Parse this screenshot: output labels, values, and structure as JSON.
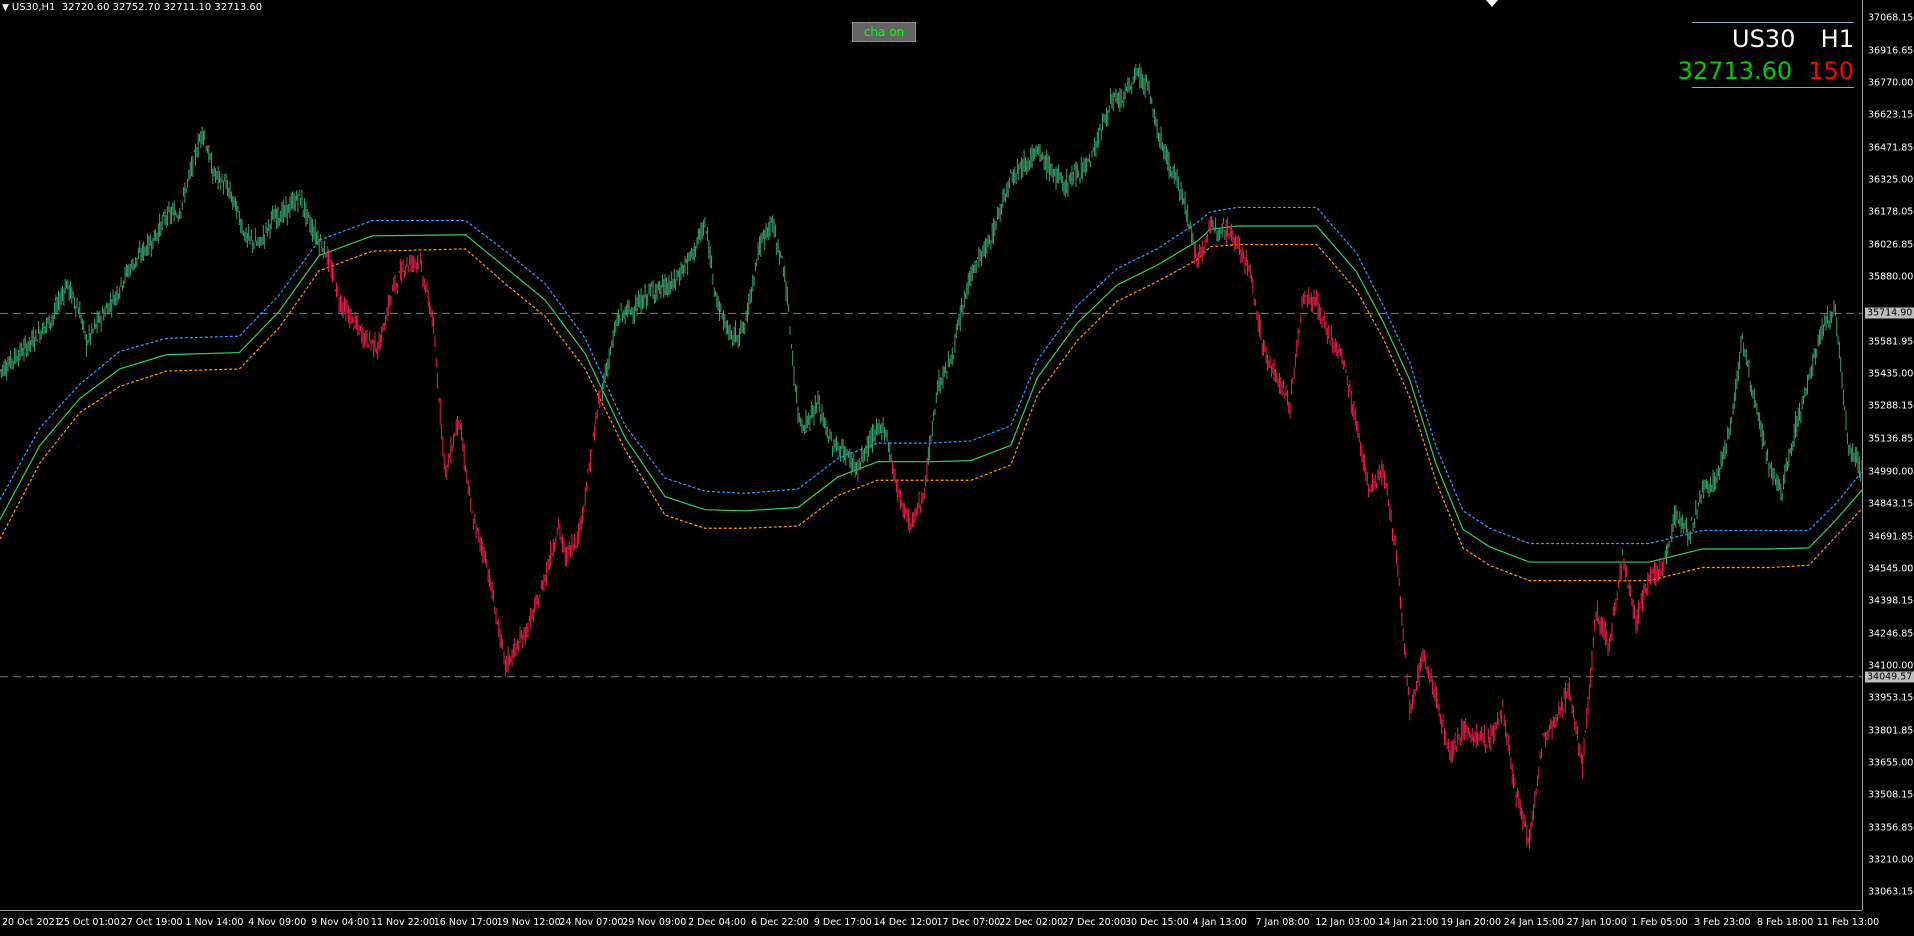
{
  "header": {
    "symbol_tf": "US30,H1",
    "ohlc": "32720.60 32752.70 32711.10 32713.60"
  },
  "button": {
    "label": "cha on"
  },
  "symbol_panel": {
    "symbol": "US30",
    "timeframe": "H1",
    "price": "32713.60",
    "spread": "150"
  },
  "colors": {
    "bull": "#3aa070",
    "bear": "#e8204a",
    "blue_band": "#3399ff",
    "orange_band": "#ff9900",
    "red_line": "#ff0000",
    "green_line": "#33cc66"
  },
  "y_axis": {
    "labels": [
      "37068.15",
      "36916.65",
      "36770.00",
      "36623.15",
      "36471.85",
      "36325.00",
      "36178.05",
      "36026.85",
      "35880.00",
      "35581.95",
      "35435.00",
      "35288.15",
      "35136.85",
      "34990.00",
      "34843.15",
      "34691.85",
      "34545.00",
      "34398.15",
      "34246.85",
      "34100.00",
      "33953.15",
      "33801.85",
      "33655.00",
      "33508.15",
      "33356.85",
      "33210.00",
      "33063.15"
    ],
    "tag_upper": "35714.90",
    "tag_lower": "34049.57"
  },
  "x_axis": {
    "labels": [
      "20 Oct 2021",
      "25 Oct 01:00",
      "27 Oct 19:00",
      "1 Nov 14:00",
      "4 Nov 09:00",
      "9 Nov 04:00",
      "11 Nov 22:00",
      "16 Nov 17:00",
      "19 Nov 12:00",
      "24 Nov 07:00",
      "29 Nov 09:00",
      "2 Dec 04:00",
      "6 Dec 22:00",
      "9 Dec 17:00",
      "14 Dec 12:00",
      "17 Dec 07:00",
      "22 Dec 02:00",
      "27 Dec 20:00",
      "30 Dec 15:00",
      "4 Jan 13:00",
      "7 Jan 08:00",
      "12 Jan 03:00",
      "14 Jan 21:00",
      "19 Jan 20:00",
      "24 Jan 15:00",
      "27 Jan 10:00",
      "1 Feb 05:00",
      "3 Feb 23:00",
      "8 Feb 18:00",
      "11 Feb 13:00"
    ]
  },
  "chart_data": {
    "type": "line",
    "ylim": [
      33063.15,
      37068.15
    ],
    "price_path": [
      [
        0,
        35450
      ],
      [
        40,
        35560
      ],
      [
        80,
        35700
      ],
      [
        100,
        35850
      ],
      [
        120,
        35720
      ],
      [
        130,
        35580
      ],
      [
        150,
        35690
      ],
      [
        175,
        35800
      ],
      [
        190,
        35900
      ],
      [
        210,
        35980
      ],
      [
        230,
        36050
      ],
      [
        250,
        36160
      ],
      [
        270,
        36180
      ],
      [
        290,
        36400
      ],
      [
        305,
        36560
      ],
      [
        320,
        36360
      ],
      [
        340,
        36300
      ],
      [
        355,
        36200
      ],
      [
        370,
        36060
      ],
      [
        390,
        36030
      ],
      [
        410,
        36150
      ],
      [
        430,
        36180
      ],
      [
        450,
        36250
      ],
      [
        470,
        36100
      ],
      [
        490,
        36000
      ],
      [
        510,
        35780
      ],
      [
        530,
        35680
      ],
      [
        550,
        35600
      ],
      [
        570,
        35560
      ],
      [
        590,
        35820
      ],
      [
        610,
        35940
      ],
      [
        630,
        35960
      ],
      [
        650,
        35700
      ],
      [
        670,
        34980
      ],
      [
        690,
        35240
      ],
      [
        710,
        34780
      ],
      [
        730,
        34600
      ],
      [
        760,
        34100
      ],
      [
        790,
        34250
      ],
      [
        810,
        34400
      ],
      [
        840,
        34740
      ],
      [
        850,
        34600
      ],
      [
        870,
        34700
      ],
      [
        880,
        34880
      ],
      [
        900,
        35300
      ],
      [
        930,
        35700
      ],
      [
        960,
        35750
      ],
      [
        980,
        35820
      ],
      [
        1010,
        35840
      ],
      [
        1040,
        35980
      ],
      [
        1060,
        36120
      ],
      [
        1080,
        35750
      ],
      [
        1100,
        35600
      ],
      [
        1120,
        35650
      ],
      [
        1140,
        36000
      ],
      [
        1160,
        36140
      ],
      [
        1180,
        35900
      ],
      [
        1200,
        35250
      ],
      [
        1210,
        35200
      ],
      [
        1230,
        35300
      ],
      [
        1250,
        35120
      ],
      [
        1270,
        35080
      ],
      [
        1290,
        35000
      ],
      [
        1310,
        35140
      ],
      [
        1330,
        35200
      ],
      [
        1350,
        34900
      ],
      [
        1370,
        34740
      ],
      [
        1390,
        34900
      ],
      [
        1410,
        35380
      ],
      [
        1430,
        35500
      ],
      [
        1460,
        35900
      ],
      [
        1490,
        36050
      ],
      [
        1520,
        36350
      ],
      [
        1560,
        36450
      ],
      [
        1600,
        36300
      ],
      [
        1640,
        36420
      ],
      [
        1670,
        36680
      ],
      [
        1690,
        36700
      ],
      [
        1710,
        36820
      ],
      [
        1725,
        36760
      ],
      [
        1740,
        36560
      ],
      [
        1760,
        36380
      ],
      [
        1780,
        36250
      ],
      [
        1800,
        35950
      ],
      [
        1820,
        36100
      ],
      [
        1840,
        36120
      ],
      [
        1860,
        36050
      ],
      [
        1880,
        35900
      ],
      [
        1900,
        35550
      ],
      [
        1915,
        35450
      ],
      [
        1940,
        35300
      ],
      [
        1960,
        35800
      ],
      [
        1980,
        35760
      ],
      [
        2000,
        35600
      ],
      [
        2020,
        35500
      ],
      [
        2040,
        35200
      ],
      [
        2060,
        34900
      ],
      [
        2080,
        35000
      ],
      [
        2100,
        34600
      ],
      [
        2120,
        33900
      ],
      [
        2140,
        34150
      ],
      [
        2160,
        33950
      ],
      [
        2180,
        33700
      ],
      [
        2200,
        33800
      ],
      [
        2220,
        33780
      ],
      [
        2240,
        33750
      ],
      [
        2260,
        33900
      ],
      [
        2280,
        33500
      ],
      [
        2300,
        33300
      ],
      [
        2320,
        33760
      ],
      [
        2340,
        33850
      ],
      [
        2360,
        34000
      ],
      [
        2380,
        33630
      ],
      [
        2400,
        34350
      ],
      [
        2420,
        34200
      ],
      [
        2440,
        34600
      ],
      [
        2460,
        34300
      ],
      [
        2480,
        34500
      ],
      [
        2500,
        34550
      ],
      [
        2520,
        34800
      ],
      [
        2540,
        34700
      ],
      [
        2560,
        34900
      ],
      [
        2580,
        34950
      ],
      [
        2600,
        35150
      ],
      [
        2620,
        35600
      ],
      [
        2640,
        35300
      ],
      [
        2660,
        35000
      ],
      [
        2680,
        34900
      ],
      [
        2700,
        35200
      ],
      [
        2720,
        35400
      ],
      [
        2740,
        35650
      ],
      [
        2760,
        35720
      ],
      [
        2780,
        35100
      ],
      [
        2800,
        34990
      ]
    ],
    "blue_band": [
      [
        0,
        34860
      ],
      [
        60,
        35190
      ],
      [
        120,
        35390
      ],
      [
        180,
        35540
      ],
      [
        250,
        35600
      ],
      [
        360,
        35610
      ],
      [
        420,
        35800
      ],
      [
        480,
        36050
      ],
      [
        560,
        36140
      ],
      [
        700,
        36140
      ],
      [
        760,
        36000
      ],
      [
        820,
        35850
      ],
      [
        880,
        35600
      ],
      [
        940,
        35200
      ],
      [
        1000,
        34960
      ],
      [
        1060,
        34900
      ],
      [
        1120,
        34890
      ],
      [
        1200,
        34910
      ],
      [
        1260,
        35050
      ],
      [
        1320,
        35120
      ],
      [
        1400,
        35120
      ],
      [
        1460,
        35130
      ],
      [
        1520,
        35200
      ],
      [
        1560,
        35500
      ],
      [
        1620,
        35750
      ],
      [
        1680,
        35920
      ],
      [
        1740,
        36010
      ],
      [
        1800,
        36130
      ],
      [
        1820,
        36180
      ],
      [
        1860,
        36200
      ],
      [
        1980,
        36200
      ],
      [
        2040,
        35990
      ],
      [
        2080,
        35750
      ],
      [
        2120,
        35490
      ],
      [
        2160,
        35100
      ],
      [
        2200,
        34810
      ],
      [
        2240,
        34730
      ],
      [
        2300,
        34660
      ],
      [
        2400,
        34660
      ],
      [
        2480,
        34660
      ],
      [
        2560,
        34720
      ],
      [
        2660,
        34720
      ],
      [
        2720,
        34720
      ],
      [
        2760,
        34840
      ],
      [
        2800,
        34990
      ]
    ],
    "orange_band": [
      [
        0,
        34680
      ],
      [
        60,
        35030
      ],
      [
        120,
        35260
      ],
      [
        180,
        35380
      ],
      [
        250,
        35450
      ],
      [
        360,
        35460
      ],
      [
        420,
        35650
      ],
      [
        480,
        35910
      ],
      [
        560,
        36000
      ],
      [
        700,
        36010
      ],
      [
        760,
        35850
      ],
      [
        820,
        35700
      ],
      [
        880,
        35460
      ],
      [
        940,
        35090
      ],
      [
        1000,
        34790
      ],
      [
        1060,
        34730
      ],
      [
        1120,
        34730
      ],
      [
        1200,
        34740
      ],
      [
        1260,
        34880
      ],
      [
        1320,
        34950
      ],
      [
        1400,
        34950
      ],
      [
        1460,
        34950
      ],
      [
        1520,
        35020
      ],
      [
        1560,
        35340
      ],
      [
        1620,
        35590
      ],
      [
        1680,
        35770
      ],
      [
        1740,
        35860
      ],
      [
        1800,
        35960
      ],
      [
        1820,
        36020
      ],
      [
        1860,
        36030
      ],
      [
        1980,
        36030
      ],
      [
        2040,
        35820
      ],
      [
        2080,
        35600
      ],
      [
        2120,
        35330
      ],
      [
        2160,
        34940
      ],
      [
        2200,
        34640
      ],
      [
        2240,
        34560
      ],
      [
        2300,
        34490
      ],
      [
        2400,
        34490
      ],
      [
        2480,
        34490
      ],
      [
        2560,
        34550
      ],
      [
        2660,
        34550
      ],
      [
        2720,
        34560
      ],
      [
        2760,
        34690
      ],
      [
        2800,
        34820
      ]
    ]
  }
}
